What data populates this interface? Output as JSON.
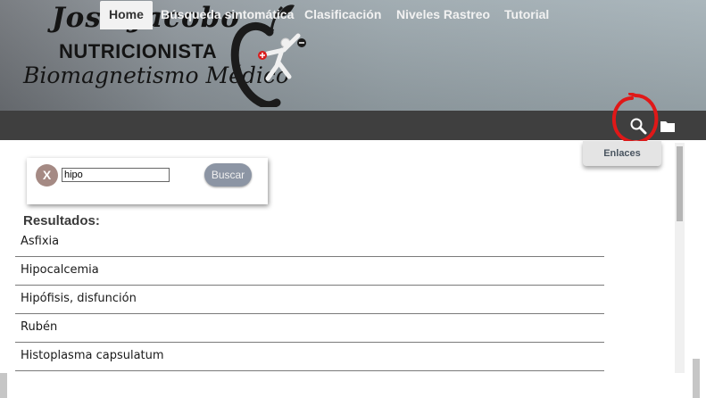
{
  "header": {
    "name": "José Jacobo",
    "role": "NUTRICIONISTA",
    "subtitle": "Biomagnetismo Médico",
    "logo_icon": "apple-figure-logo"
  },
  "nav": {
    "tabs": [
      {
        "label": "Home",
        "active": true
      },
      {
        "label": "Búsqueda sintomática",
        "active": false
      },
      {
        "label": "Clasificación",
        "active": false
      },
      {
        "label": "Niveles Rastreo",
        "active": false
      },
      {
        "label": "Tutorial",
        "active": false
      }
    ],
    "search_icon": "search-icon",
    "folder_icon": "folder-icon"
  },
  "dropdown": {
    "item": "Enlaces"
  },
  "search": {
    "clear_label": "X",
    "value": "hipo",
    "button_label": "Buscar"
  },
  "results": {
    "title": "Resultados:",
    "items": [
      "Asfixia",
      "Hipocalcemia",
      "Hipófisis, disfunción",
      "Rubén",
      "Histoplasma capsulatum"
    ]
  },
  "colors": {
    "navbar": "#3f3f3f",
    "annotation": "#e01818",
    "buscar_button": "#8c95a4",
    "clear_button": "#a58a84"
  }
}
